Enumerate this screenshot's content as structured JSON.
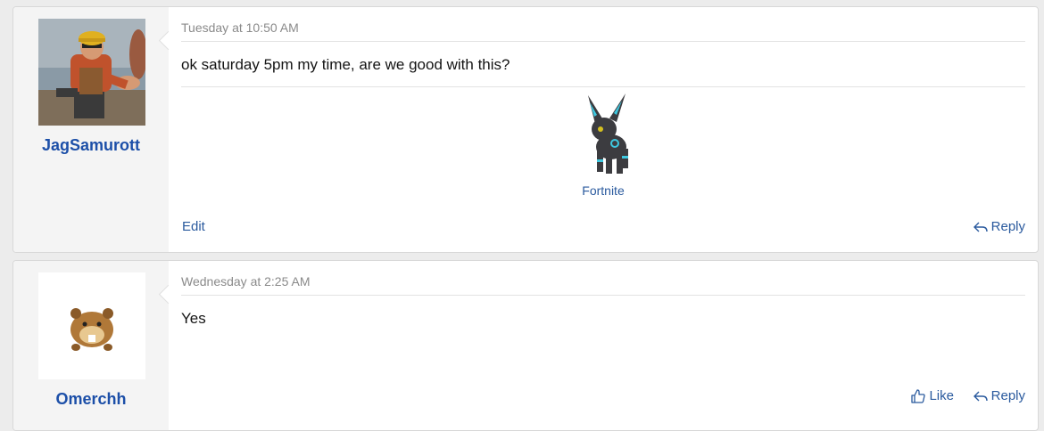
{
  "posts": [
    {
      "username": "JagSamurott",
      "date": "Tuesday at 10:50 AM",
      "message": "ok saturday 5pm my time, are we good with this?",
      "signature_link": "Fortnite",
      "edit_label": "Edit",
      "reply_label": "Reply",
      "avatar_icon": "engineer-avatar",
      "signature_icon": "umbreon-sprite"
    },
    {
      "username": "Omerchh",
      "date": "Wednesday at 2:25 AM",
      "message": "Yes",
      "like_label": "Like",
      "reply_label": "Reply",
      "avatar_icon": "bidoof-avatar"
    }
  ],
  "colors": {
    "username": "#1c4fa8",
    "link": "#2a5a9e",
    "date": "#8a8a8a",
    "page_bg": "#ececec",
    "user_cell_bg": "#f4f4f4"
  }
}
